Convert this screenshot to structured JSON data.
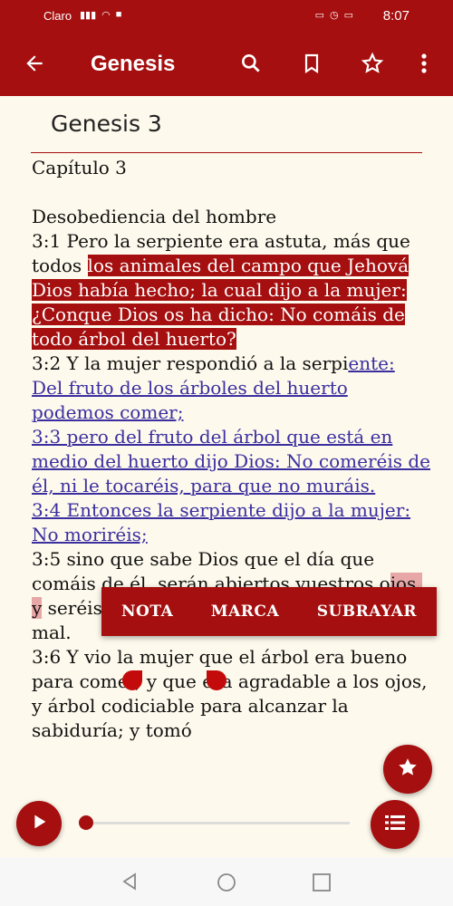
{
  "status_bar": {
    "carrier": "Claro",
    "time": "8:07"
  },
  "app_bar": {
    "title": "Genesis"
  },
  "content": {
    "book_title": "Genesis 3",
    "chapter": "Capítulo 3",
    "heading": "Desobediencia del hombre",
    "v1_plain": "3:1 Pero la serpiente era astuta, más que todos ",
    "v1_hl": "los animales del campo que Jehová Dios había hecho; la cual dijo a la mujer: ¿Conque Dios os ha dicho: No comáis de todo árbol del huerto?",
    "v2_plain": "3:2 Y la mujer respondió a la serpi",
    "v2_ul": "ente: Del fruto de los árboles del huerto podemos comer;",
    "v3_ul": "3:3 pero del fruto del árbol que está en medio del huerto dijo Dios: No comeréis de él, ni le tocaréis, para que no muráis.",
    "v4_ul": "3:4 Entonces la serpiente dijo a la mujer: No moriréis;",
    "v5_a": "3:5 sino que sabe Dios que el día que comáis de él, serán abiertos vuestros o",
    "v5_sel": "jos, y",
    "v5_b": " seréis como Dios, sabiendo el bien y el mal.",
    "v6": "3:6 Y vio la mujer que el árbol era bueno para comer, y que era agradable a los ojos, y árbol codiciable para alcanzar la sabiduría; y tomó"
  },
  "selection_menu": {
    "note": "NOTA",
    "mark": "MARCA",
    "underline": "SUBRAYAR"
  },
  "audio_player": {
    "progress": 0.0
  },
  "icons": {
    "back": "arrow-left-icon",
    "search": "search-icon",
    "bookmark": "bookmark-icon",
    "star": "star-outline-icon",
    "more": "more-vert-icon",
    "play": "play-icon",
    "list": "list-icon",
    "fab_star": "star-icon"
  },
  "colors": {
    "primary": "#a50f0f",
    "page_bg": "#fdf9ec",
    "link": "#3b2fa0",
    "selection": "#e8a7a7"
  }
}
